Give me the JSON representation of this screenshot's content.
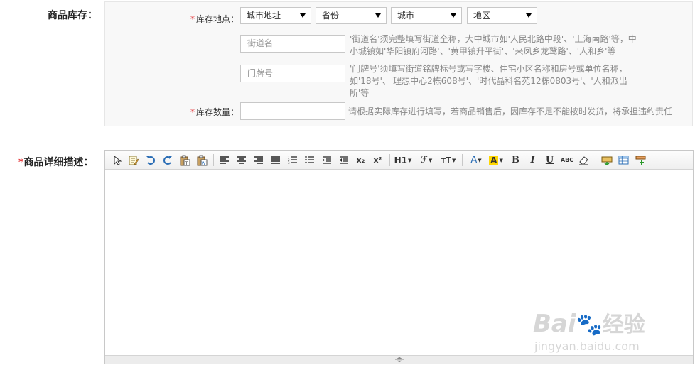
{
  "stock": {
    "section_label": "商品库存：",
    "location_label": "库存地点：",
    "required_star": "*",
    "selects": {
      "address_type": "城市地址",
      "province": "省份",
      "city": "城市",
      "district": "地区"
    },
    "street": {
      "placeholder": "街道名",
      "hint_line1": "'街道名'须完整填写街道全称，大中城市如'人民北路中段'、'上海南路'等，中",
      "hint_line2": "小城镇如'华阳镇府河路'、'黄甲镇升平街'、'来凤乡龙鹫路'、'人和乡'等"
    },
    "door": {
      "placeholder": "门牌号",
      "hint_line1": "'门牌号'须填写街道铭牌标号或写字楼、住宅小区名称和房号或单位名称，",
      "hint_line2": "如'18号'、'理想中心2栋608号'、'时代晶科名苑12栋0803号'、'人和派出",
      "hint_line3": "所'等"
    },
    "quantity_label": "库存数量：",
    "quantity_hint": "请根据实际库存进行填写，若商品销售后，因库存不足不能按时发货，将承担违约责任"
  },
  "detail": {
    "section_label": "商品详细描述：",
    "required_star": "*",
    "toolbar": {
      "heading_label": "H1",
      "font_family_label": "ℱ",
      "font_size_label": "тT",
      "font_color_label": "A",
      "highlight_label": "A",
      "bold_label": "B",
      "italic_label": "I",
      "underline_label": "U",
      "strike_label": "ABC",
      "subscript_label": "x₂",
      "superscript_label": "x²"
    }
  },
  "watermark": {
    "brand_text": "Bai",
    "brand_suffix": "经验",
    "url": "jingyan.baidu.com"
  },
  "colors": {
    "required": "#e4393c",
    "panel_bg": "#f8f8f8",
    "hint_text": "#888888"
  }
}
